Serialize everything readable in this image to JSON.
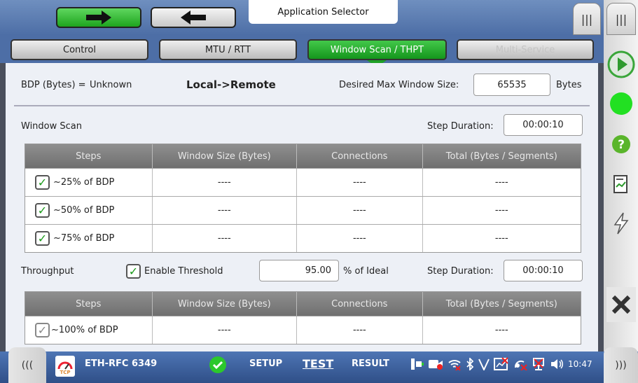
{
  "app_selector": "Application Selector",
  "tabs": [
    "Control",
    "MTU / RTT",
    "Window Scan / THPT",
    "Multi-Service"
  ],
  "bdp": {
    "label": "BDP (Bytes) =",
    "value": "Unknown"
  },
  "direction": "Local->Remote",
  "desired": {
    "label": "Desired Max Window Size:",
    "value": "65535",
    "unit": "Bytes"
  },
  "window_scan": {
    "title": "Window Scan",
    "step_label": "Step Duration:",
    "step_value": "00:00:10",
    "columns": [
      "Steps",
      "Window Size (Bytes)",
      "Connections",
      "Total (Bytes / Segments)"
    ],
    "rows": [
      {
        "step": "~25% of BDP",
        "window": "----",
        "connections": "----",
        "total": "----"
      },
      {
        "step": "~50% of BDP",
        "window": "----",
        "connections": "----",
        "total": "----"
      },
      {
        "step": "~75% of BDP",
        "window": "----",
        "connections": "----",
        "total": "----"
      }
    ]
  },
  "throughput": {
    "title": "Throughput",
    "enable_label": "Enable Threshold",
    "threshold": "95.00",
    "ideal_label": "% of Ideal",
    "step_label": "Step Duration:",
    "step_value": "00:00:10",
    "columns": [
      "Steps",
      "Window Size (Bytes)",
      "Connections",
      "Total (Bytes / Segments)"
    ],
    "rows": [
      {
        "step": "~100% of BDP",
        "window": "----",
        "connections": "----",
        "total": "----"
      }
    ]
  },
  "statusbar": {
    "test_name": "ETH-RFC 6349",
    "tcp_badge": "TCP",
    "setup": "SETUP",
    "test": "TEST",
    "result": "RESULT",
    "time": "10:47"
  },
  "colors": {
    "accent_green": "#1ea41e",
    "header_blue": "#4d6ea6",
    "status_bar": "#2f4f88"
  },
  "icons": [
    "forward-arrow-icon",
    "back-arrow-icon",
    "menu-icon",
    "play-icon",
    "status-led-icon",
    "help-icon",
    "report-icon",
    "lightning-icon",
    "close-icon",
    "chevrons-left-icon",
    "chevrons-right-icon",
    "check-icon"
  ]
}
